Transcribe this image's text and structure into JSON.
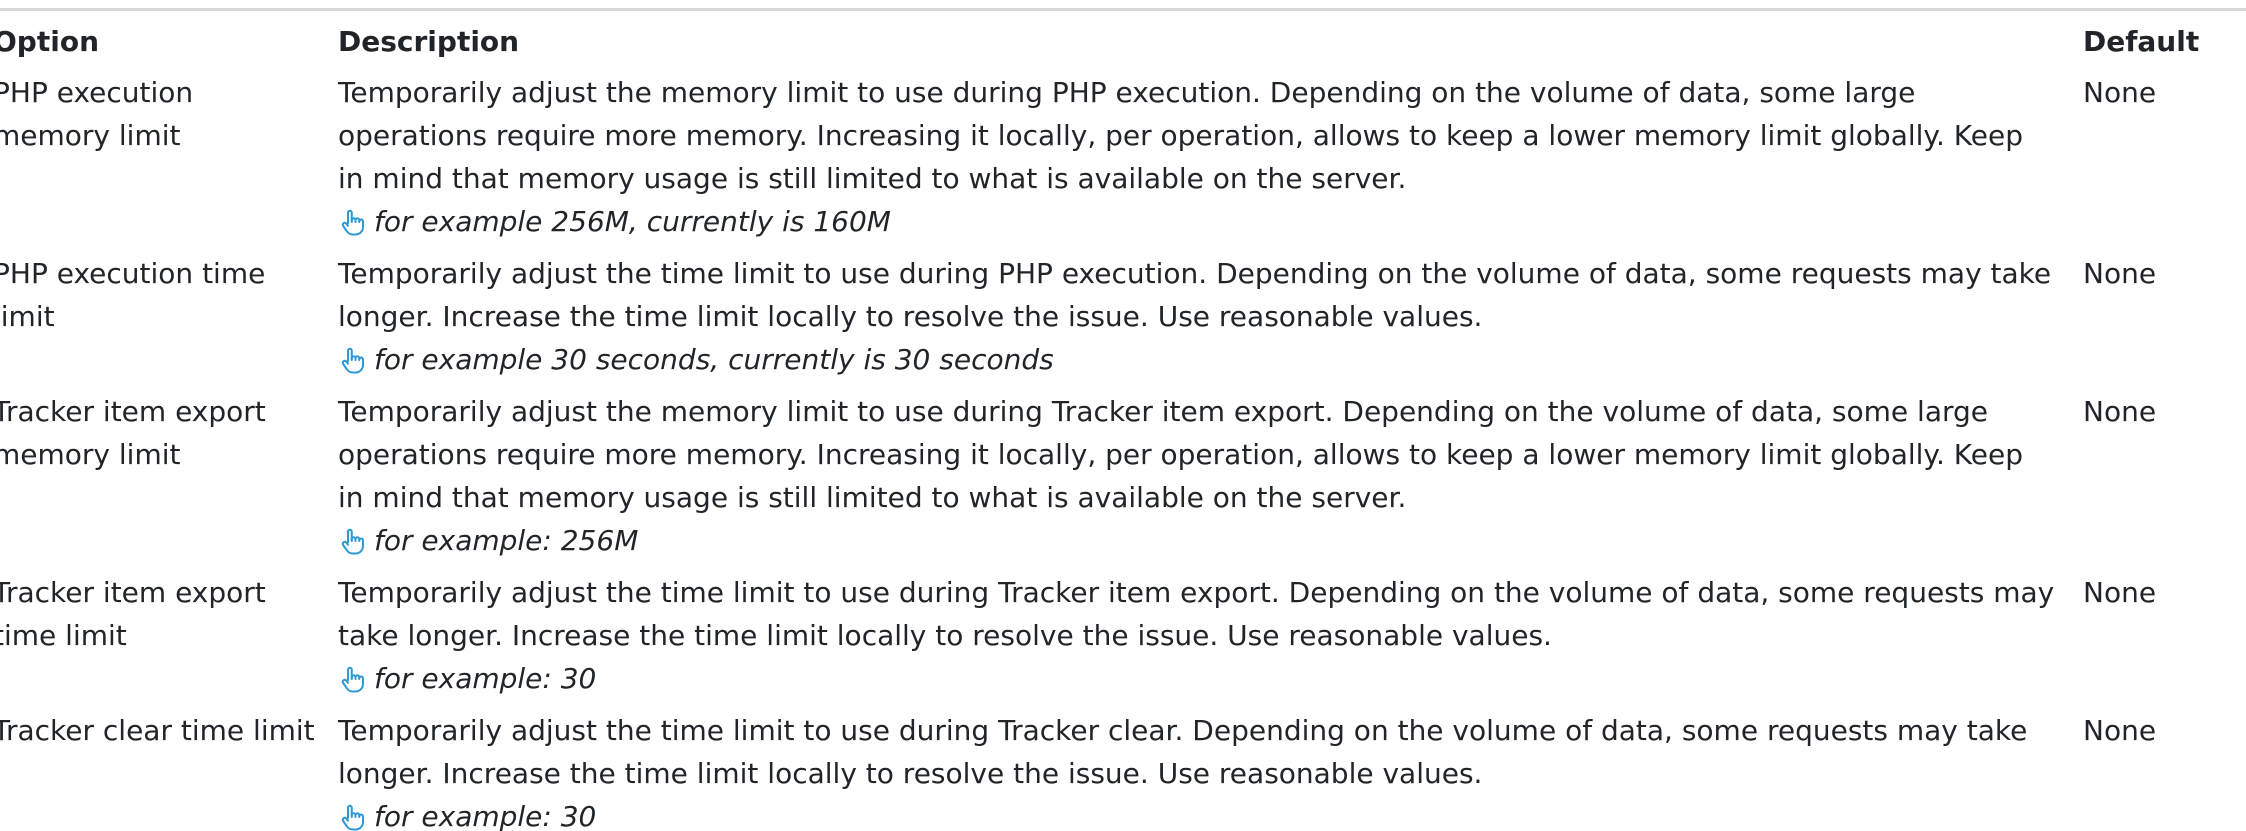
{
  "table": {
    "headers": {
      "option": "Option",
      "description": "Description",
      "default": "Default"
    },
    "rows": [
      {
        "option": "PHP execution memory limit",
        "description": "Temporarily adjust the memory limit to use during PHP execution. Depending on the volume of data, some large operations require more memory. Increasing it locally, per operation, allows to keep a lower memory limit globally. Keep in mind that memory usage is still limited to what is available on the server.",
        "example": "for example 256M, currently is 160M",
        "example_icon": "hand-pointer-icon",
        "default": "None"
      },
      {
        "option": "PHP execution time limit",
        "description": "Temporarily adjust the time limit to use during PHP execution. Depending on the volume of data, some requests may take longer. Increase the time limit locally to resolve the issue. Use reasonable values.",
        "example": "for example 30 seconds, currently is 30 seconds",
        "example_icon": "hand-pointer-icon",
        "default": "None"
      },
      {
        "option": "Tracker item export memory limit",
        "description": "Temporarily adjust the memory limit to use during Tracker item export. Depending on the volume of data, some large operations require more memory. Increasing it locally, per operation, allows to keep a lower memory limit globally. Keep in mind that memory usage is still limited to what is available on the server.",
        "example": "for example: 256M",
        "example_icon": "hand-pointer-icon",
        "default": "None"
      },
      {
        "option": "Tracker item export time limit",
        "description": "Temporarily adjust the time limit to use during Tracker item export. Depending on the volume of data, some requests may take longer. Increase the time limit locally to resolve the issue. Use reasonable values.",
        "example": "for example: 30",
        "example_icon": "hand-pointer-icon",
        "default": "None"
      },
      {
        "option": "Tracker clear time limit",
        "description": "Temporarily adjust the time limit to use during Tracker clear. Depending on the volume of data, some requests may take longer. Increase the time limit locally to resolve the issue. Use reasonable values.",
        "example": "for example: 30",
        "example_icon": "hand-pointer-icon",
        "default": "None"
      }
    ]
  },
  "colors": {
    "text": "#212529",
    "icon": "#2b9ad4",
    "rule": "#d6d8da"
  }
}
